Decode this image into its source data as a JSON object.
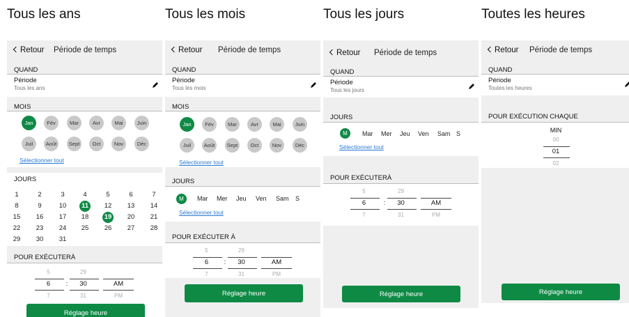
{
  "captions": [
    "Tous les ans",
    "Tous les mois",
    "Tous les jours",
    "Toutes les heures"
  ],
  "header": {
    "back": "Retour",
    "title": "Période de temps"
  },
  "quand": "QUAND",
  "periode_label": "Période",
  "periode_values": [
    "Tous les ans",
    "Tous les mois",
    "Tous les jours",
    "Toutes les heures"
  ],
  "mois_label": "MOIS",
  "months": [
    "Jan",
    "Fév",
    "Mar",
    "Avr",
    "Mai",
    "Juin",
    "Juil",
    "Août",
    "Sept",
    "Oct",
    "Nov",
    "Déc"
  ],
  "select_all": "Sélectionner tout",
  "jours_label": "JOURS",
  "days": [
    [
      "1",
      "2",
      "3",
      "4",
      "5",
      "6",
      "7"
    ],
    [
      "8",
      "9",
      "10",
      "11",
      "12",
      "13",
      "14"
    ],
    [
      "15",
      "16",
      "17",
      "18",
      "19",
      "20",
      "21"
    ],
    [
      "22",
      "23",
      "24",
      "25",
      "26",
      "27",
      "28"
    ],
    [
      "29",
      "30",
      "31"
    ]
  ],
  "selected_days": [
    "11",
    "19"
  ],
  "weekdays": [
    "M",
    "Mar",
    "Mer",
    "Jeu",
    "Ven",
    "Sam",
    "S"
  ],
  "execute_label_a": "POUR EXÉCUTERÀ",
  "execute_label_b": "POUR EXÉCUTER À",
  "execute_each": "POUR EXÉCUTION CHAQUE",
  "time_picker": {
    "hours": [
      "5",
      "6",
      "7"
    ],
    "minutes": [
      "29",
      "30",
      "31"
    ],
    "ampm": [
      "",
      "AM",
      "PM"
    ],
    "sep": ":"
  },
  "min_picker": {
    "label": "MIN",
    "values": [
      "00",
      "01",
      "02"
    ]
  },
  "button": "Réglage heure",
  "colors": {
    "accent": "#0e8a45",
    "link": "#2a7ad6",
    "bg": "#efefef"
  }
}
